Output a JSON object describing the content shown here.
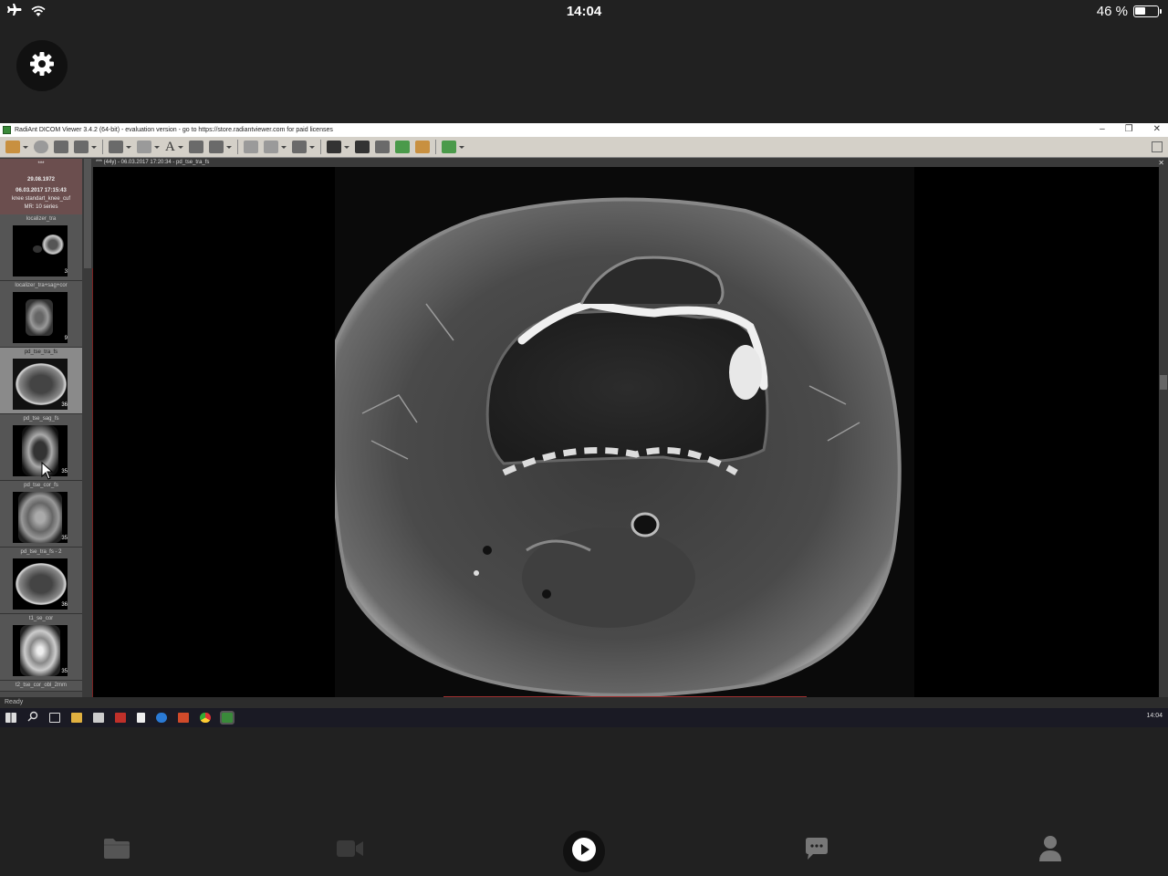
{
  "status_bar": {
    "time": "14:04",
    "battery_text": "46 %",
    "battery_level": 0.46
  },
  "remote_window": {
    "title": "RadiAnt DICOM Viewer 3.4.2 (64-bit) - evaluation version - go to https://store.radiantviewer.com for paid licenses",
    "window_buttons": [
      "–",
      "❐",
      "✕"
    ]
  },
  "patient": {
    "name": "***",
    "birth_date": "29.08.1972",
    "study_datetime": "06.03.2017 17:15:43",
    "study_desc": "knee standart_knee_cuf",
    "modality_series": "MR: 10 series"
  },
  "series": [
    {
      "label": "localizer_tra",
      "count": "3"
    },
    {
      "label": "localizer_tra+sag+cor",
      "count": "9"
    },
    {
      "label": "pd_tse_tra_fs",
      "count": "36"
    },
    {
      "label": "pd_tse_sag_fs",
      "count": "35"
    },
    {
      "label": "pd_tse_cor_fs",
      "count": "35"
    },
    {
      "label": "pd_tse_tra_fs - 2",
      "count": "36"
    },
    {
      "label": "t1_se_cor",
      "count": "35"
    },
    {
      "label": "t2_tse_cor_obl_2mm",
      "count": ""
    }
  ],
  "viewer": {
    "header": "*** (44y) - 06.03.2017 17:20:34 - pd_tse_tra_fs",
    "close": "✕"
  },
  "status_line": "Ready",
  "taskbar": {
    "clock": "14:04",
    "icons": [
      "windows-start-icon",
      "search-icon",
      "task-view-icon",
      "file-explorer-icon",
      "store-icon",
      "acrobat-icon",
      "file-icon",
      "edge-icon",
      "powerpoint-icon",
      "chrome-icon",
      "radiant-icon"
    ]
  },
  "bottom_nav": [
    "folder-icon",
    "video-icon",
    "play-icon",
    "chat-icon",
    "profile-icon"
  ],
  "colors": {
    "background": "#212121",
    "patient_panel": "#6b4e4e",
    "accent_red": "#a03030"
  }
}
